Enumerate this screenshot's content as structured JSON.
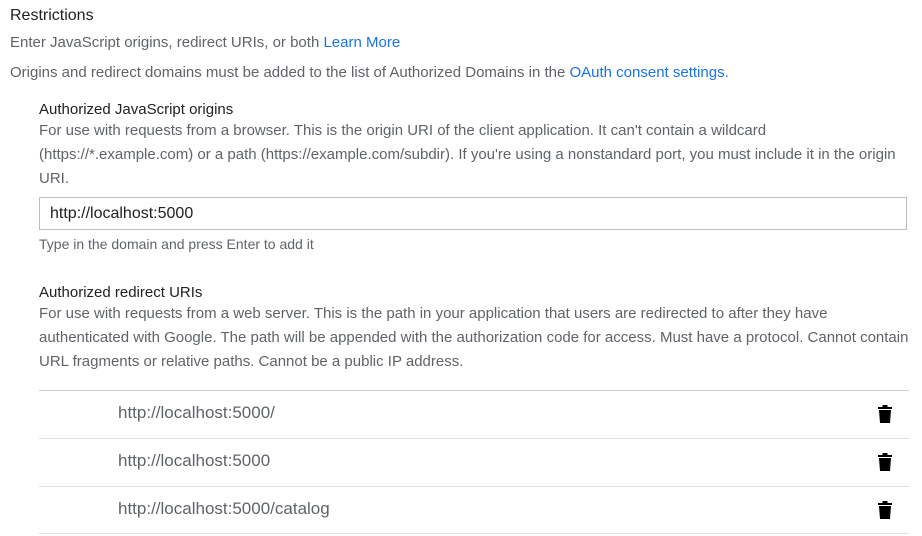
{
  "restrictions": {
    "title": "Restrictions",
    "subtitle_text": "Enter JavaScript origins, redirect URIs, or both",
    "learn_more": "Learn More",
    "domains_note": "Origins and redirect domains must be added to the list of Authorized Domains in the",
    "consent_link": "OAuth consent settings",
    "consent_period": "."
  },
  "js_origins": {
    "title": "Authorized JavaScript origins",
    "description": "For use with requests from a browser. This is the origin URI of the client application. It can't contain a wildcard (https://*.example.com) or a path (https://example.com/subdir). If you're using a nonstandard port, you must include it in the origin URI.",
    "input_value": "http://localhost:5000",
    "hint": "Type in the domain and press Enter to add it"
  },
  "redirect_uris": {
    "title": "Authorized redirect URIs",
    "description": "For use with requests from a web server. This is the path in your application that users are redirected to after they have authenticated with Google. The path will be appended with the authorization code for access. Must have a protocol. Cannot contain URL fragments or relative paths. Cannot be a public IP address.",
    "items": [
      {
        "uri": "http://localhost:5000/",
        "delete_icon": "trash-icon"
      },
      {
        "uri": "http://localhost:5000",
        "delete_icon": "trash-icon"
      },
      {
        "uri": "http://localhost:5000/catalog",
        "delete_icon": "trash-icon"
      }
    ]
  },
  "colors": {
    "link": "#1a73e8",
    "text": "#212121",
    "secondary_text": "#5f6368",
    "border": "#bdbdbd"
  }
}
